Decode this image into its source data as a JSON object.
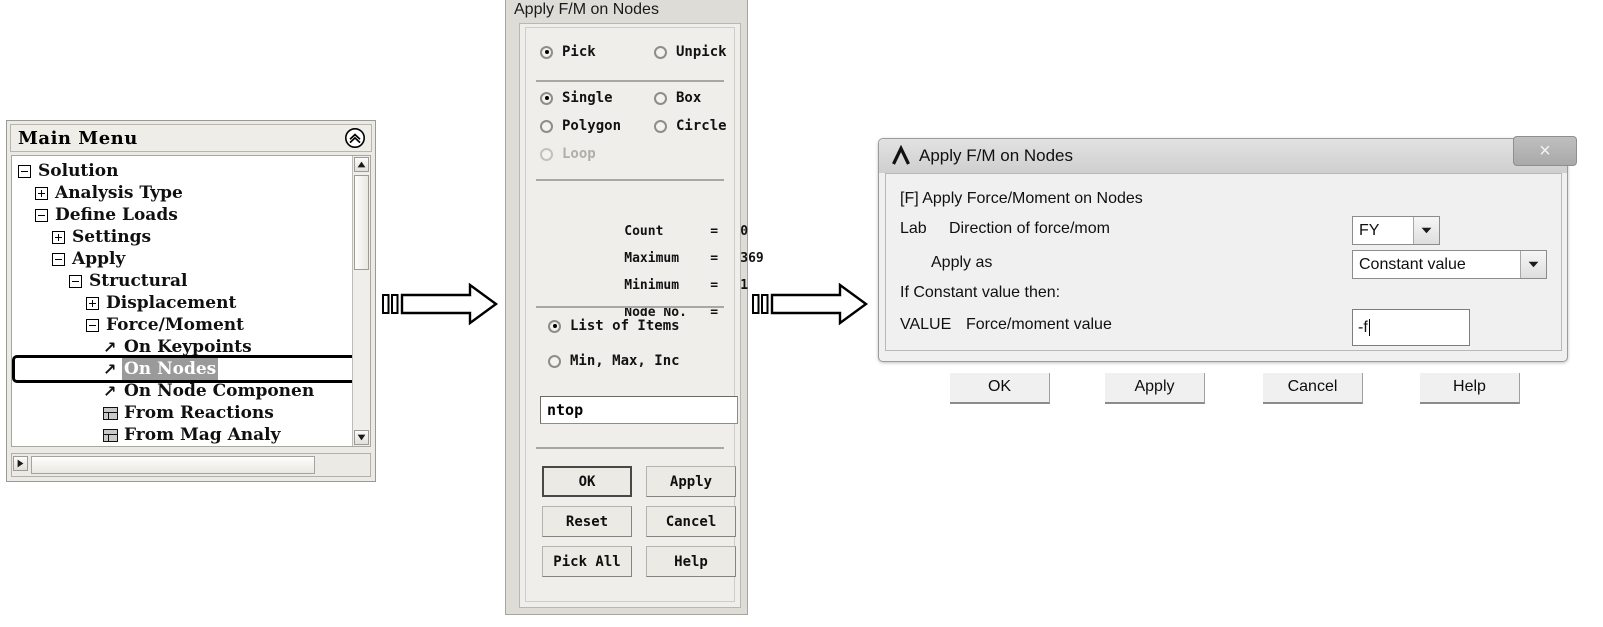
{
  "main_menu": {
    "title": "Main Menu",
    "collapse_icon": "chevron-double-up-icon",
    "tree": [
      {
        "label": "Solution",
        "indent": 0,
        "icon": "minus-toggle",
        "selected": false
      },
      {
        "label": "Analysis Type",
        "indent": 1,
        "icon": "plus-toggle",
        "selected": false
      },
      {
        "label": "Define Loads",
        "indent": 1,
        "icon": "minus-toggle",
        "selected": false
      },
      {
        "label": "Settings",
        "indent": 2,
        "icon": "plus-toggle",
        "selected": false
      },
      {
        "label": "Apply",
        "indent": 2,
        "icon": "minus-toggle",
        "selected": false
      },
      {
        "label": "Structural",
        "indent": 3,
        "icon": "minus-toggle",
        "selected": false
      },
      {
        "label": "Displacement",
        "indent": 4,
        "icon": "plus-toggle",
        "selected": false
      },
      {
        "label": "Force/Moment",
        "indent": 4,
        "icon": "minus-toggle",
        "selected": false
      },
      {
        "label": "On Keypoints",
        "indent": 5,
        "icon": "pick-arrow",
        "selected": false
      },
      {
        "label": "On Nodes",
        "indent": 5,
        "icon": "pick-arrow",
        "selected": true
      },
      {
        "label": "On Node Componen",
        "indent": 5,
        "icon": "pick-arrow",
        "selected": false
      },
      {
        "label": "From Reactions",
        "indent": 5,
        "icon": "table-grid",
        "selected": false
      },
      {
        "label": "From Mag Analy",
        "indent": 5,
        "icon": "table-grid",
        "selected": false
      }
    ],
    "scroll_up_icon": "triangle-up-icon",
    "scroll_down_icon": "triangle-down-icon",
    "scroll_left_icon": "triangle-left-icon",
    "scroll_right_icon": "triangle-right-icon"
  },
  "flow_arrows": [
    {
      "name": "arrow-menu-to-picker"
    },
    {
      "name": "arrow-picker-to-dialog"
    }
  ],
  "picker": {
    "title": "Apply F/M on Nodes",
    "mode_options": [
      {
        "label": "Pick",
        "selected": true,
        "disabled": false
      },
      {
        "label": "Unpick",
        "selected": false,
        "disabled": false
      }
    ],
    "shape_options": [
      {
        "label": "Single",
        "selected": true,
        "disabled": false
      },
      {
        "label": "Box",
        "selected": false,
        "disabled": false
      },
      {
        "label": "Polygon",
        "selected": false,
        "disabled": false
      },
      {
        "label": "Circle",
        "selected": false,
        "disabled": false
      },
      {
        "label": "Loop",
        "selected": false,
        "disabled": true
      }
    ],
    "stats": [
      {
        "name": "Count",
        "eq": "=",
        "value": "0"
      },
      {
        "name": "Maximum",
        "eq": "=",
        "value": "369"
      },
      {
        "name": "Minimum",
        "eq": "=",
        "value": "1"
      },
      {
        "name": "Node No.",
        "eq": "=",
        "value": ""
      }
    ],
    "entry_options": [
      {
        "label": "List of Items",
        "selected": true
      },
      {
        "label": "Min, Max, Inc",
        "selected": false
      }
    ],
    "input_value": "ntop",
    "input_placeholder": "",
    "buttons": [
      {
        "label": "OK",
        "default": true
      },
      {
        "label": "Apply",
        "default": false
      },
      {
        "label": "Reset",
        "default": false
      },
      {
        "label": "Cancel",
        "default": false
      },
      {
        "label": "Pick All",
        "default": false
      },
      {
        "label": "Help",
        "default": false
      }
    ]
  },
  "fm_dialog": {
    "title": "Apply F/M on Nodes",
    "logo_icon": "ansys-lambda-icon",
    "close_label": "×",
    "command_line": "[F]  Apply Force/Moment on Nodes",
    "lab_prefix": "Lab",
    "lab_text": "Direction of force/mom",
    "lab_value": "FY",
    "apply_as_text": "Apply as",
    "apply_as_value": "Constant value",
    "constant_note": "If Constant value then:",
    "value_prefix": "VALUE",
    "value_text": "Force/moment value",
    "value_input": "-f",
    "buttons": [
      {
        "label": "OK"
      },
      {
        "label": "Apply"
      },
      {
        "label": "Cancel"
      },
      {
        "label": "Help"
      }
    ]
  },
  "colors": {
    "page_bg": "#ffffff",
    "panel_bg": "#eceae4",
    "dialog_bg": "#f0f0f0",
    "selection_bg": "#9a9a9a",
    "titlebar_grad_top": "#e2e2e2",
    "titlebar_grad_bottom": "#cfcfcf"
  }
}
